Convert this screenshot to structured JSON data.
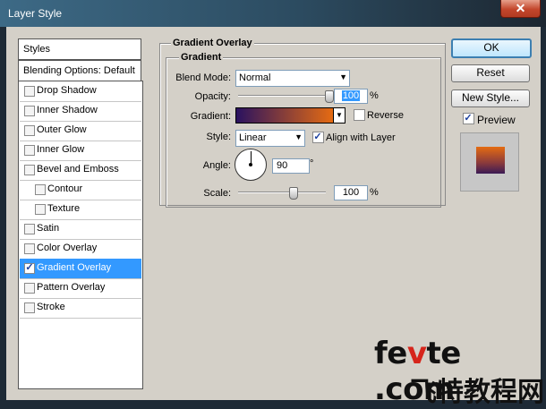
{
  "window": {
    "title": "Layer Style"
  },
  "styles_list": {
    "header": "Styles",
    "blending_options": "Blending Options: Default",
    "effects": [
      {
        "label": "Drop Shadow",
        "checked": false,
        "indent": false,
        "selected": false
      },
      {
        "label": "Inner Shadow",
        "checked": false,
        "indent": false,
        "selected": false
      },
      {
        "label": "Outer Glow",
        "checked": false,
        "indent": false,
        "selected": false
      },
      {
        "label": "Inner Glow",
        "checked": false,
        "indent": false,
        "selected": false
      },
      {
        "label": "Bevel and Emboss",
        "checked": false,
        "indent": false,
        "selected": false
      },
      {
        "label": "Contour",
        "checked": false,
        "indent": true,
        "selected": false
      },
      {
        "label": "Texture",
        "checked": false,
        "indent": true,
        "selected": false
      },
      {
        "label": "Satin",
        "checked": false,
        "indent": false,
        "selected": false
      },
      {
        "label": "Color Overlay",
        "checked": false,
        "indent": false,
        "selected": false
      },
      {
        "label": "Gradient Overlay",
        "checked": true,
        "indent": false,
        "selected": true
      },
      {
        "label": "Pattern Overlay",
        "checked": false,
        "indent": false,
        "selected": false
      },
      {
        "label": "Stroke",
        "checked": false,
        "indent": false,
        "selected": false
      }
    ]
  },
  "panel": {
    "title": "Gradient Overlay",
    "group_title": "Gradient",
    "blend_mode": {
      "label": "Blend Mode:",
      "value": "Normal"
    },
    "opacity": {
      "label": "Opacity:",
      "value": "100",
      "unit": "%",
      "level": 1.0
    },
    "gradient": {
      "label": "Gradient:",
      "colors": [
        "#2a1260",
        "#e56b12"
      ]
    },
    "reverse": {
      "label": "Reverse",
      "checked": false
    },
    "style": {
      "label": "Style:",
      "value": "Linear"
    },
    "align_with_layer": {
      "label": "Align with Layer",
      "checked": true
    },
    "angle": {
      "label": "Angle:",
      "value": "90",
      "unit": "°"
    },
    "scale": {
      "label": "Scale:",
      "value": "100",
      "unit": "%",
      "level": 0.5
    }
  },
  "buttons": {
    "ok": "OK",
    "reset": "Reset",
    "new_style": "New Style..."
  },
  "preview": {
    "label": "Preview",
    "checked": true
  },
  "watermark": {
    "line1_a": "fe",
    "line1_v": "v",
    "line1_b": "te .com",
    "line2": "飞特教程网"
  }
}
